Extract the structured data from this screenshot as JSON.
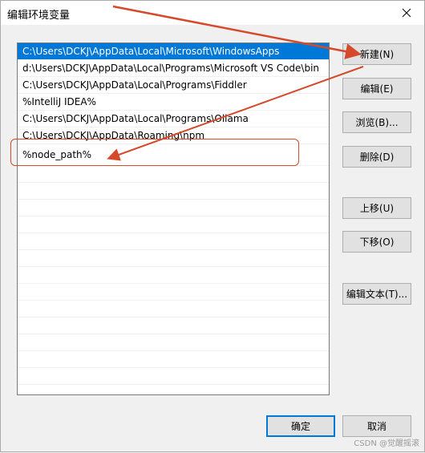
{
  "window": {
    "title": "编辑环境变量",
    "close_label": "×"
  },
  "list": {
    "items": [
      "C:\\Users\\DCKJ\\AppData\\Local\\Microsoft\\WindowsApps",
      "d:\\Users\\DCKJ\\AppData\\Local\\Programs\\Microsoft VS Code\\bin",
      "C:\\Users\\DCKJ\\AppData\\Local\\Programs\\Fiddler",
      "%IntelliJ IDEA%",
      "C:\\Users\\DCKJ\\AppData\\Local\\Programs\\Ollama",
      "C:\\Users\\DCKJ\\AppData\\Roaming\\npm",
      "%node_path%"
    ],
    "selected_index": 0
  },
  "buttons": {
    "new": "新建(N)",
    "edit": "编辑(E)",
    "browse": "浏览(B)...",
    "delete": "删除(D)",
    "move_up": "上移(U)",
    "move_down": "下移(O)",
    "edit_text": "编辑文本(T)...",
    "ok": "确定",
    "cancel": "取消"
  },
  "annotation": {
    "color": "#d44a2a"
  },
  "watermark": "CSDN @觉醒摇滚"
}
